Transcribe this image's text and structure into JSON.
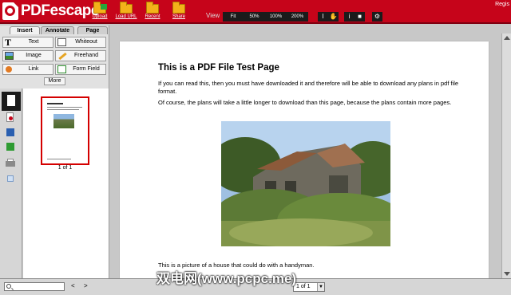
{
  "app": {
    "logo_text": "PDFescape",
    "register_label": "Regis"
  },
  "toolbar": {
    "upload": "Upload",
    "load_url": "Load URL",
    "recent": "Recent",
    "share": "Share",
    "view_label": "View",
    "zoom": [
      "Fit",
      "50%",
      "100%",
      "200%"
    ]
  },
  "tabs": {
    "insert": "Insert",
    "annotate": "Annotate",
    "page": "Page"
  },
  "insert_tools": {
    "text": "Text",
    "whiteout": "Whiteout",
    "image": "Image",
    "freehand": "Freehand",
    "link": "Link",
    "form_field": "Form Field",
    "more": "More"
  },
  "thumbnail": {
    "label": "1 of 1"
  },
  "document": {
    "title": "This is a PDF File Test Page",
    "para1": "If you can read this, then you must have downloaded it and therefore will be able to download any plans in pdf file format.",
    "para2": "Of course, the plans will take a little longer to download than this page, because the plans contain more pages.",
    "caption": "This is a picture of a house that could do with a handyman."
  },
  "bottom": {
    "search_value": "",
    "prev": "<",
    "next": ">",
    "page_select": "1 of 1",
    "watermark": "双电网(www.pcpc.me)"
  },
  "colors": {
    "brand_red": "#c6041a",
    "thumb_border": "#d40000"
  }
}
